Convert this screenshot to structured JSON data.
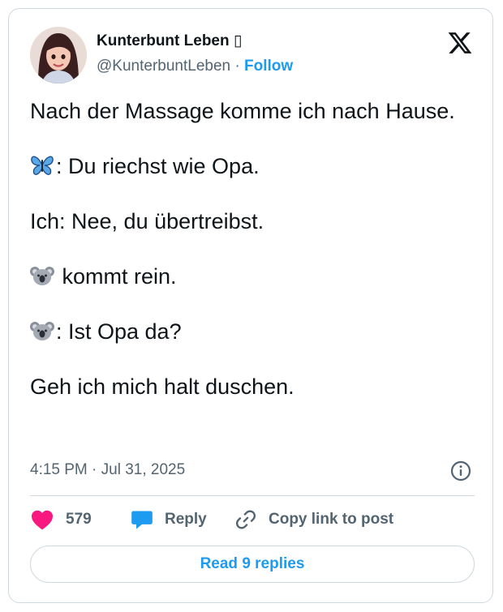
{
  "author": {
    "display_name": "Kunterbunt Leben ▯",
    "handle": "@KunterbuntLeben",
    "separator": "·",
    "follow_label": "Follow"
  },
  "tweet": {
    "line1": "Nach der Massage komme ich nach Hause.",
    "line2_text": ": Du riechst wie Opa.",
    "line3": "Ich: Nee, du übertreibst.",
    "line4_text": " kommt rein.",
    "line5_text": ": Ist Opa da?",
    "line6": "Geh ich mich halt duschen."
  },
  "icons": {
    "line2": "butterfly-icon",
    "line4": "koala-icon",
    "line5": "koala-icon",
    "brand": "x-logo-icon",
    "info": "info-icon",
    "like": "heart-icon",
    "reply": "reply-bubble-icon",
    "copy": "link-icon"
  },
  "meta": {
    "timestamp": "4:15 PM · Jul 31, 2025"
  },
  "actions": {
    "like_count": "579",
    "reply_label": "Reply",
    "copy_label": "Copy link to post"
  },
  "footer": {
    "read_replies_label": "Read 9 replies"
  },
  "colors": {
    "accent": "#1d9bf0",
    "like": "#f91880",
    "text": "#0f1419",
    "muted": "#536471",
    "border": "#cfd9de"
  }
}
